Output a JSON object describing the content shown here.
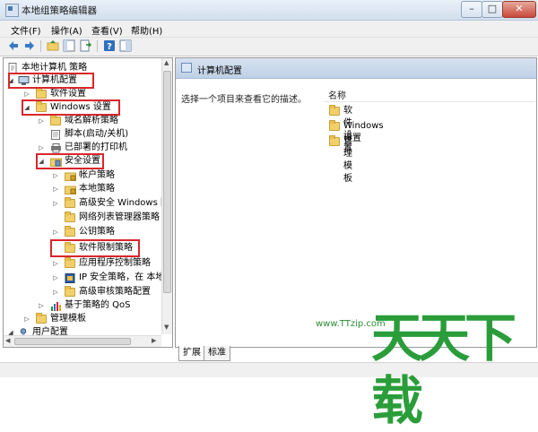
{
  "window": {
    "title": "本地组策略编辑器",
    "minimize": "–",
    "maximize": "□",
    "close": "✕"
  },
  "menu": [
    "文件(F)",
    "操作(A)",
    "查看(V)",
    "帮助(H)"
  ],
  "tree": {
    "root": "本地计算机 策略",
    "computer_config": "计算机配置",
    "software_settings": "软件设置",
    "windows_settings": "Windows 设置",
    "dns": "域名解析策略",
    "scripts": "脚本(启动/关机)",
    "printers": "已部署的打印机",
    "security_settings": "安全设置",
    "account_policies": "帐户策略",
    "local_policies": "本地策略",
    "firewall": "高级安全 Windows 防",
    "nlm": "网络列表管理器策略",
    "public_key": "公钥策略",
    "srp": "软件限制策略",
    "applocker": "应用程序控制策略",
    "ipsec": "IP 安全策略，在 本地",
    "audit": "高级审核策略配置",
    "qos": "基于策略的 QoS",
    "admin_templates": "管理模板",
    "user_config": "用户配置"
  },
  "detail": {
    "header": "计算机配置",
    "description": "选择一个项目来查看它的描述。",
    "column_name": "名称",
    "items": [
      "软件设置",
      "Windows 设置",
      "管理模板"
    ]
  },
  "tabs": [
    "扩展",
    "标准"
  ],
  "watermark": {
    "url": "www.TTzip.com",
    "logo": "天天下载"
  },
  "colors": {
    "highlight": "#d9262b",
    "folder": "#f1cf6a",
    "header": "#c9d8ea",
    "watermark": "#2a9d3a"
  }
}
